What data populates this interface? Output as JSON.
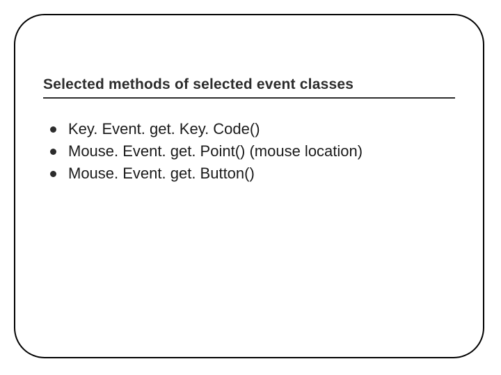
{
  "slide": {
    "title": "Selected methods of selected event classes",
    "bullets": [
      "Key. Event. get. Key. Code()",
      "Mouse. Event. get. Point() (mouse location)",
      "Mouse. Event. get. Button()"
    ]
  }
}
